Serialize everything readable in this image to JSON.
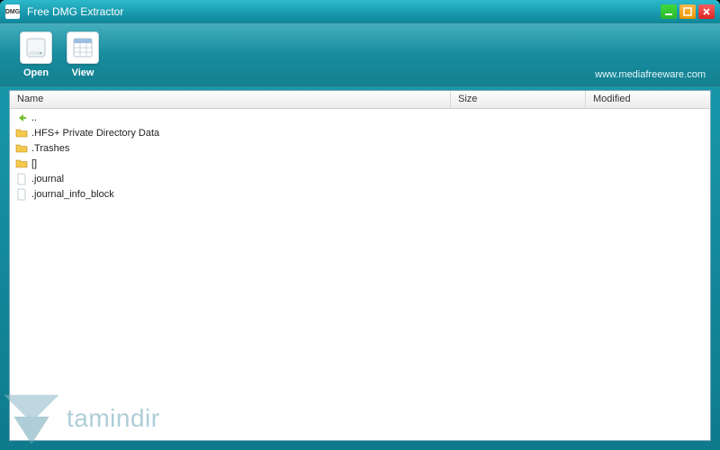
{
  "window": {
    "title": "Free DMG Extractor",
    "app_icon_text": "DMG"
  },
  "toolbar": {
    "open_label": "Open",
    "view_label": "View",
    "website": "www.mediafreeware.com"
  },
  "columns": {
    "name": "Name",
    "size": "Size",
    "modified": "Modified"
  },
  "rows": [
    {
      "icon": "back",
      "name": ".."
    },
    {
      "icon": "folder",
      "name": ".HFS+ Private Directory Data"
    },
    {
      "icon": "folder",
      "name": ".Trashes"
    },
    {
      "icon": "folder",
      "name": "[]"
    },
    {
      "icon": "file",
      "name": ".journal"
    },
    {
      "icon": "file",
      "name": ".journal_info_block"
    }
  ],
  "watermark": {
    "text": "tamindir"
  }
}
